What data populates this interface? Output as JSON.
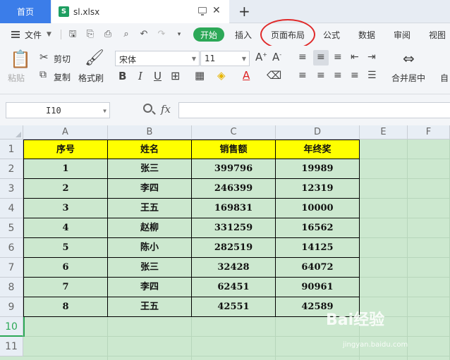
{
  "tabs": {
    "home": "首页",
    "file": "sl.xlsx",
    "file_icon": "S",
    "add": "+"
  },
  "menu": {
    "file": "文件",
    "start": "开始",
    "items": [
      "插入",
      "页面布局",
      "公式",
      "数据",
      "审阅",
      "视图"
    ]
  },
  "ribbon": {
    "paste": "粘贴",
    "cut": "剪切",
    "copy": "复制",
    "format_painter": "格式刷",
    "font": "宋体",
    "size": "11",
    "merge": "合并居中",
    "auto": "自"
  },
  "formula": {
    "namebox": "I10",
    "fx": "fx",
    "value": ""
  },
  "columns": [
    "A",
    "B",
    "C",
    "D",
    "E",
    "F"
  ],
  "rows": [
    "1",
    "2",
    "3",
    "4",
    "5",
    "6",
    "7",
    "8",
    "9",
    "10",
    "11"
  ],
  "table": {
    "header": [
      "序号",
      "姓名",
      "销售额",
      "年终奖"
    ],
    "data": [
      [
        "1",
        "张三",
        "399796",
        "19989"
      ],
      [
        "2",
        "李四",
        "246399",
        "12319"
      ],
      [
        "3",
        "王五",
        "169831",
        "10000"
      ],
      [
        "4",
        "赵柳",
        "331259",
        "16562"
      ],
      [
        "5",
        "陈小",
        "282519",
        "14125"
      ],
      [
        "6",
        "张三",
        "32428",
        "64072"
      ],
      [
        "7",
        "李四",
        "62451",
        "90961"
      ],
      [
        "8",
        "王五",
        "42551",
        "42589"
      ]
    ]
  },
  "watermark": {
    "brand": "Bai经验",
    "url": "jingyan.baidu.com"
  },
  "colors": {
    "accent": "#2ca857",
    "header_fill": "#ffff00",
    "grid_bg": "#cce8cf",
    "home_tab": "#3b7de9",
    "highlight_circle": "#e02a2a"
  }
}
